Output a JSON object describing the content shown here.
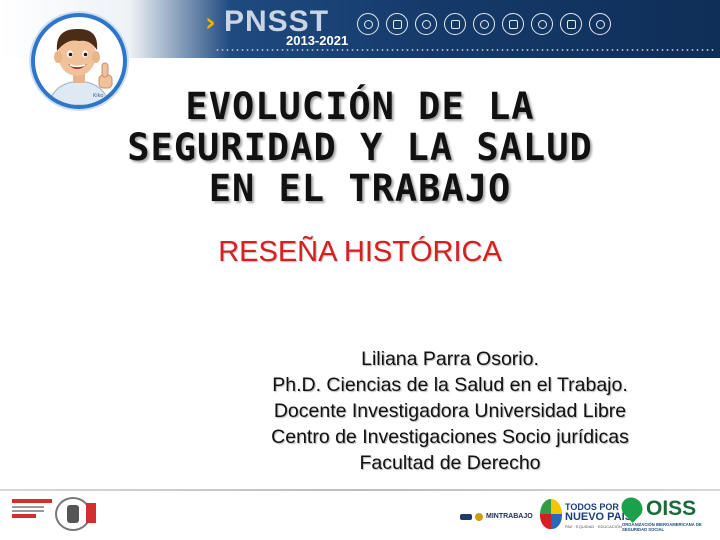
{
  "header": {
    "brand_name": "PNSST",
    "brand_years": "2013-2021",
    "chevron_glyph": "›",
    "icons": [
      "worker-icon",
      "hardhat-icon",
      "vehicle-icon",
      "document-icon",
      "group-icon",
      "warning-icon",
      "health-icon",
      "factory-icon",
      "nurse-icon"
    ]
  },
  "mascot": {
    "icon": "smiling-mascot-thumbs-up-icon",
    "shirt_label": "Kiko"
  },
  "slide": {
    "title_lines": [
      "EVOLUCIÓN DE LA",
      "SEGURIDAD Y LA SALUD",
      "EN EL TRABAJO"
    ],
    "subtitle": "RESEÑA HISTÓRICA",
    "author_lines": [
      "Liliana Parra Osorio.",
      "Ph.D. Ciencias de la Salud en el Trabajo.",
      "Docente Investigadora Universidad Libre",
      "Centro de Investigaciones Socio jurídicas",
      "Facultad de Derecho"
    ]
  },
  "footer": {
    "certifications": [
      "iso-certification-logo",
      "bureau-veritas-seal"
    ],
    "ministry": "MINTRABAJO",
    "government_line1": "TODOS POR UN",
    "government_line2": "NUEVO PAÍS",
    "government_tagline": "PAZ · EQUIDAD · EDUCACIÓN",
    "oiss_name": "OISS",
    "oiss_full": "ORGANIZACIÓN IBEROAMERICANA DE SEGURIDAD SOCIAL"
  },
  "colors": {
    "banner": "#153a6a",
    "accent_yellow": "#f4b400",
    "subtitle_red": "#d62020",
    "mascot_ring": "#2f75c9"
  }
}
